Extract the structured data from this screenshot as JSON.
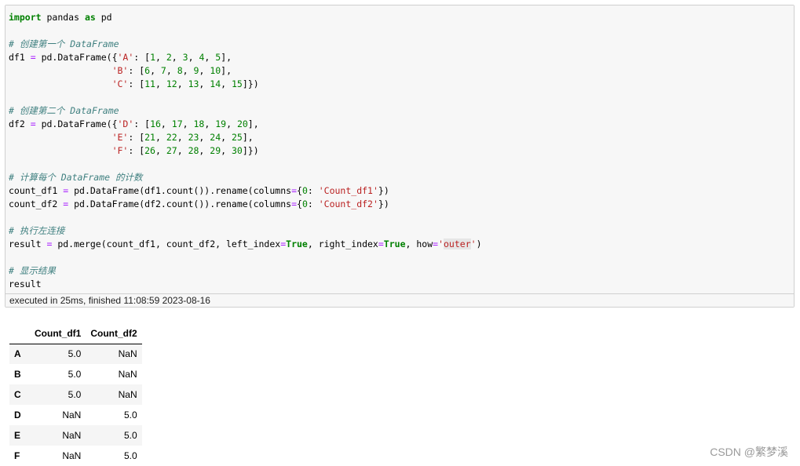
{
  "code_lines": [
    [
      {
        "t": "import",
        "c": "kw"
      },
      {
        "t": " pandas ",
        "c": ""
      },
      {
        "t": "as",
        "c": "kw"
      },
      {
        "t": " pd",
        "c": ""
      }
    ],
    [],
    [
      {
        "t": "# 创建第一个 DataFrame",
        "c": "cm"
      }
    ],
    [
      {
        "t": "df1 ",
        "c": ""
      },
      {
        "t": "=",
        "c": "op"
      },
      {
        "t": " pd.DataFrame({",
        "c": ""
      },
      {
        "t": "'A'",
        "c": "str"
      },
      {
        "t": ": [",
        "c": ""
      },
      {
        "t": "1",
        "c": "num"
      },
      {
        "t": ", ",
        "c": ""
      },
      {
        "t": "2",
        "c": "num"
      },
      {
        "t": ", ",
        "c": ""
      },
      {
        "t": "3",
        "c": "num"
      },
      {
        "t": ", ",
        "c": ""
      },
      {
        "t": "4",
        "c": "num"
      },
      {
        "t": ", ",
        "c": ""
      },
      {
        "t": "5",
        "c": "num"
      },
      {
        "t": "],",
        "c": ""
      }
    ],
    [
      {
        "t": "                   ",
        "c": ""
      },
      {
        "t": "'B'",
        "c": "str"
      },
      {
        "t": ": [",
        "c": ""
      },
      {
        "t": "6",
        "c": "num"
      },
      {
        "t": ", ",
        "c": ""
      },
      {
        "t": "7",
        "c": "num"
      },
      {
        "t": ", ",
        "c": ""
      },
      {
        "t": "8",
        "c": "num"
      },
      {
        "t": ", ",
        "c": ""
      },
      {
        "t": "9",
        "c": "num"
      },
      {
        "t": ", ",
        "c": ""
      },
      {
        "t": "10",
        "c": "num"
      },
      {
        "t": "],",
        "c": ""
      }
    ],
    [
      {
        "t": "                   ",
        "c": ""
      },
      {
        "t": "'C'",
        "c": "str"
      },
      {
        "t": ": [",
        "c": ""
      },
      {
        "t": "11",
        "c": "num"
      },
      {
        "t": ", ",
        "c": ""
      },
      {
        "t": "12",
        "c": "num"
      },
      {
        "t": ", ",
        "c": ""
      },
      {
        "t": "13",
        "c": "num"
      },
      {
        "t": ", ",
        "c": ""
      },
      {
        "t": "14",
        "c": "num"
      },
      {
        "t": ", ",
        "c": ""
      },
      {
        "t": "15",
        "c": "num"
      },
      {
        "t": "]})",
        "c": ""
      }
    ],
    [],
    [
      {
        "t": "# 创建第二个 DataFrame",
        "c": "cm"
      }
    ],
    [
      {
        "t": "df2 ",
        "c": ""
      },
      {
        "t": "=",
        "c": "op"
      },
      {
        "t": " pd.DataFrame({",
        "c": ""
      },
      {
        "t": "'D'",
        "c": "str"
      },
      {
        "t": ": [",
        "c": ""
      },
      {
        "t": "16",
        "c": "num"
      },
      {
        "t": ", ",
        "c": ""
      },
      {
        "t": "17",
        "c": "num"
      },
      {
        "t": ", ",
        "c": ""
      },
      {
        "t": "18",
        "c": "num"
      },
      {
        "t": ", ",
        "c": ""
      },
      {
        "t": "19",
        "c": "num"
      },
      {
        "t": ", ",
        "c": ""
      },
      {
        "t": "20",
        "c": "num"
      },
      {
        "t": "],",
        "c": ""
      }
    ],
    [
      {
        "t": "                   ",
        "c": ""
      },
      {
        "t": "'E'",
        "c": "str"
      },
      {
        "t": ": [",
        "c": ""
      },
      {
        "t": "21",
        "c": "num"
      },
      {
        "t": ", ",
        "c": ""
      },
      {
        "t": "22",
        "c": "num"
      },
      {
        "t": ", ",
        "c": ""
      },
      {
        "t": "23",
        "c": "num"
      },
      {
        "t": ", ",
        "c": ""
      },
      {
        "t": "24",
        "c": "num"
      },
      {
        "t": ", ",
        "c": ""
      },
      {
        "t": "25",
        "c": "num"
      },
      {
        "t": "],",
        "c": ""
      }
    ],
    [
      {
        "t": "                   ",
        "c": ""
      },
      {
        "t": "'F'",
        "c": "str"
      },
      {
        "t": ": [",
        "c": ""
      },
      {
        "t": "26",
        "c": "num"
      },
      {
        "t": ", ",
        "c": ""
      },
      {
        "t": "27",
        "c": "num"
      },
      {
        "t": ", ",
        "c": ""
      },
      {
        "t": "28",
        "c": "num"
      },
      {
        "t": ", ",
        "c": ""
      },
      {
        "t": "29",
        "c": "num"
      },
      {
        "t": ", ",
        "c": ""
      },
      {
        "t": "30",
        "c": "num"
      },
      {
        "t": "]})",
        "c": ""
      }
    ],
    [],
    [
      {
        "t": "# 计算每个 DataFrame 的计数",
        "c": "cm"
      }
    ],
    [
      {
        "t": "count_df1 ",
        "c": ""
      },
      {
        "t": "=",
        "c": "op"
      },
      {
        "t": " pd.DataFrame(df1.count()).rename(columns",
        "c": ""
      },
      {
        "t": "=",
        "c": "op"
      },
      {
        "t": "{",
        "c": ""
      },
      {
        "t": "0",
        "c": "num"
      },
      {
        "t": ": ",
        "c": ""
      },
      {
        "t": "'Count_df1'",
        "c": "str"
      },
      {
        "t": "})",
        "c": ""
      }
    ],
    [
      {
        "t": "count_df2 ",
        "c": ""
      },
      {
        "t": "=",
        "c": "op"
      },
      {
        "t": " pd.DataFrame(df2.count()).rename(columns",
        "c": ""
      },
      {
        "t": "=",
        "c": "op"
      },
      {
        "t": "{",
        "c": ""
      },
      {
        "t": "0",
        "c": "num"
      },
      {
        "t": ": ",
        "c": ""
      },
      {
        "t": "'Count_df2'",
        "c": "str"
      },
      {
        "t": "})",
        "c": ""
      }
    ],
    [],
    [
      {
        "t": "# 执行左连接",
        "c": "cm"
      }
    ],
    [
      {
        "t": "result ",
        "c": ""
      },
      {
        "t": "=",
        "c": "op"
      },
      {
        "t": " pd.merge(count_df1, count_df2, left_index",
        "c": ""
      },
      {
        "t": "=",
        "c": "op"
      },
      {
        "t": "True",
        "c": "kw"
      },
      {
        "t": ", right_index",
        "c": ""
      },
      {
        "t": "=",
        "c": "op"
      },
      {
        "t": "True",
        "c": "kw"
      },
      {
        "t": ", how",
        "c": ""
      },
      {
        "t": "=",
        "c": "op"
      },
      {
        "t": "'",
        "c": "str"
      },
      {
        "t": "outer",
        "c": "str mark"
      },
      {
        "t": "'",
        "c": "str"
      },
      {
        "t": ")",
        "c": ""
      }
    ],
    [],
    [
      {
        "t": "# 显示结果",
        "c": "cm"
      }
    ],
    [
      {
        "t": "result",
        "c": ""
      }
    ]
  ],
  "execution_info": "executed in 25ms, finished 11:08:59 2023-08-16",
  "table": {
    "columns": [
      "Count_df1",
      "Count_df2"
    ],
    "rows": [
      {
        "index": "A",
        "values": [
          "5.0",
          "NaN"
        ]
      },
      {
        "index": "B",
        "values": [
          "5.0",
          "NaN"
        ]
      },
      {
        "index": "C",
        "values": [
          "5.0",
          "NaN"
        ]
      },
      {
        "index": "D",
        "values": [
          "NaN",
          "5.0"
        ]
      },
      {
        "index": "E",
        "values": [
          "NaN",
          "5.0"
        ]
      },
      {
        "index": "F",
        "values": [
          "NaN",
          "5.0"
        ]
      }
    ]
  },
  "watermark": "CSDN @繁梦溪"
}
